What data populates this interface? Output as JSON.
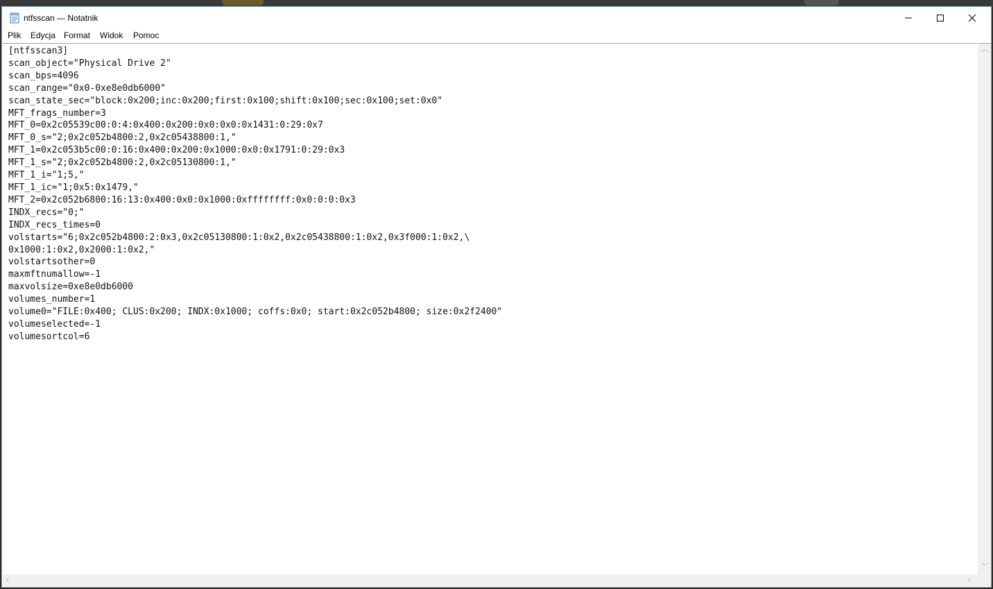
{
  "window": {
    "title": "ntfsscan — Notatnik",
    "icon": "notepad-icon"
  },
  "caption_buttons": {
    "minimize": "minimize-icon",
    "maximize": "maximize-icon",
    "close": "close-icon"
  },
  "menu": [
    "Plik",
    "Edycja",
    "Format",
    "Widok",
    "Pomoc"
  ],
  "editor": {
    "lines": [
      "[ntfsscan3]",
      "scan_object=\"Physical Drive 2\"",
      "scan_bps=4096",
      "scan_range=\"0x0-0xe8e0db6000\"",
      "scan_state_sec=\"block:0x200;inc:0x200;first:0x100;shift:0x100;sec:0x100;set:0x0\"",
      "MFT_frags_number=3",
      "MFT_0=0x2c05539c00:0:4:0x400:0x200:0x0:0x0:0x1431:0:29:0x7",
      "MFT_0_s=\"2;0x2c052b4800:2,0x2c05438800:1,\"",
      "MFT_1=0x2c053b5c00:0:16:0x400:0x200:0x1000:0x0:0x1791:0:29:0x3",
      "MFT_1_s=\"2;0x2c052b4800:2,0x2c05130800:1,\"",
      "MFT_1_i=\"1;5,\"",
      "MFT_1_ic=\"1;0x5:0x1479,\"",
      "MFT_2=0x2c052b6800:16:13:0x400:0x0:0x1000:0xffffffff:0x0:0:0:0x3",
      "INDX_recs=\"0;\"",
      "INDX_recs_times=0",
      "volstarts=\"6;0x2c052b4800:2:0x3,0x2c05130800:1:0x2,0x2c05438800:1:0x2,0x3f000:1:0x2,\\",
      "0x1000:1:0x2,0x2000:1:0x2,\"",
      "volstartsother=0",
      "maxmftnumallow=-1",
      "maxvolsize=0xe8e0db6000",
      "volumes_number=1",
      "volume0=\"FILE:0x400; CLUS:0x200; INDX:0x1000; coffs:0x0; start:0x2c052b4800; size:0x2f2400\"",
      "volumeselected=-1",
      "volumesortcol=6"
    ]
  },
  "scrollbars": {
    "up": "chevron-up-icon",
    "down": "chevron-down-icon",
    "left": "chevron-left-icon",
    "right": "chevron-right-icon"
  }
}
